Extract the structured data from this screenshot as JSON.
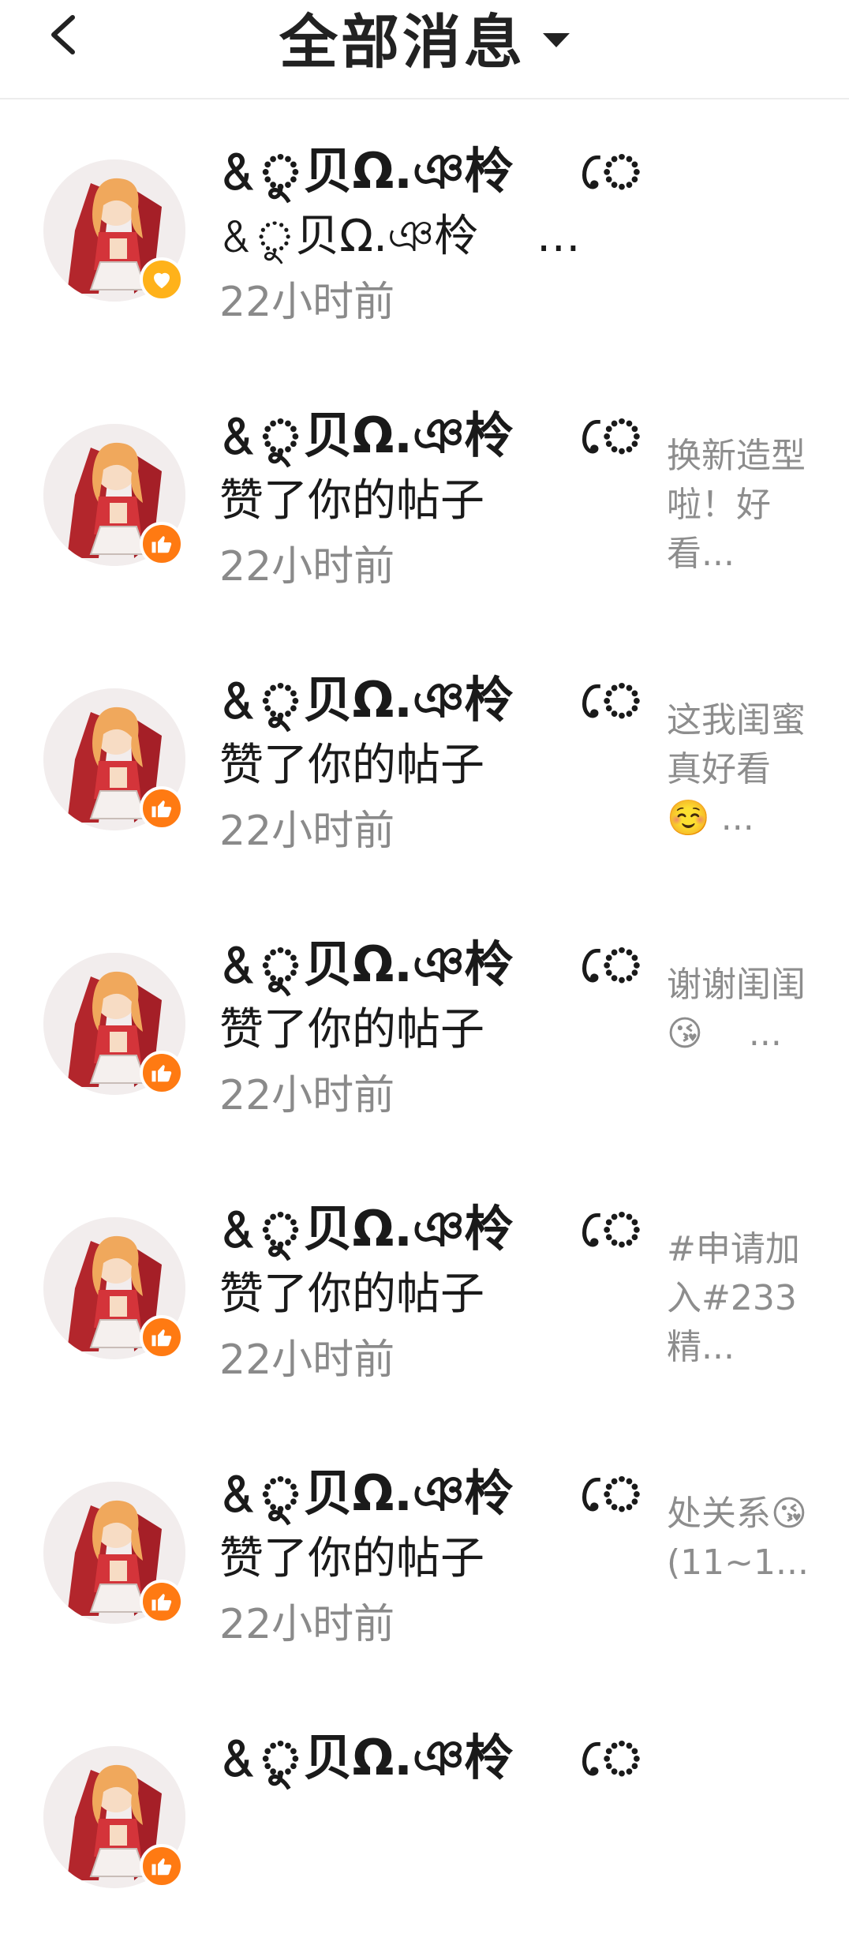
{
  "header": {
    "title": "全部消息"
  },
  "items": [
    {
      "name": "&ু贝Ω.ঞ柃　 ে",
      "action": "&ু贝Ω.ঞ柃　 ে关...",
      "time": "22小时前",
      "badge": "heart-icon",
      "preview": ""
    },
    {
      "name": "&ু贝Ω.ঞ柃　 ে",
      "action": "赞了你的帖子",
      "time": "22小时前",
      "badge": "thumbs-up-icon",
      "preview": "换新造型啦！好看..."
    },
    {
      "name": "&ু贝Ω.ঞ柃　 ে",
      "action": "赞了你的帖子",
      "time": "22小时前",
      "badge": "thumbs-up-icon",
      "preview": "这我闺蜜真好看☺️ ..."
    },
    {
      "name": "&ু贝Ω.ঞ柃　 ে",
      "action": "赞了你的帖子",
      "time": "22小时前",
      "badge": "thumbs-up-icon",
      "preview": "谢谢闺闺😘　 ..."
    },
    {
      "name": "&ু贝Ω.ঞ柃　 ে",
      "action": "赞了你的帖子",
      "time": "22小时前",
      "badge": "thumbs-up-icon",
      "preview": "#申请加入#233精..."
    },
    {
      "name": "&ু贝Ω.ঞ柃　 ে",
      "action": "赞了你的帖子",
      "time": "22小时前",
      "badge": "thumbs-up-icon",
      "preview": "处关系😘(11~1..."
    },
    {
      "name": "&ু贝Ω.ঞ柃　 ে",
      "action": "",
      "time": "",
      "badge": "thumbs-up-icon",
      "preview": ""
    }
  ]
}
